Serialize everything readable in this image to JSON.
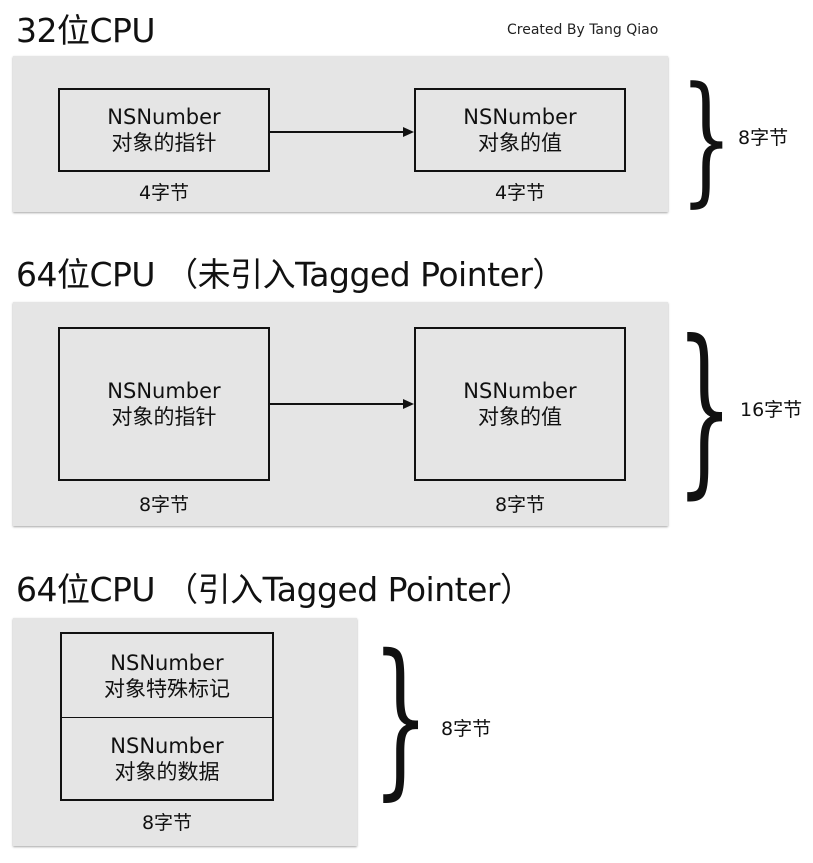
{
  "credit": "Created By Tang Qiao",
  "sections": [
    {
      "title": "32位CPU",
      "left_box": {
        "line1": "NSNumber",
        "line2": "对象的指针"
      },
      "right_box": {
        "line1": "NSNumber",
        "line2": "对象的值"
      },
      "left_size": "4字节",
      "right_size": "4字节",
      "total": "8字节"
    },
    {
      "title": "64位CPU （未引入Tagged Pointer）",
      "left_box": {
        "line1": "NSNumber",
        "line2": "对象的指针"
      },
      "right_box": {
        "line1": "NSNumber",
        "line2": "对象的值"
      },
      "left_size": "8字节",
      "right_size": "8字节",
      "total": "16字节"
    },
    {
      "title": "64位CPU （引入Tagged Pointer）",
      "top_box": {
        "line1": "NSNumber",
        "line2": "对象特殊标记"
      },
      "bottom_box": {
        "line1": "NSNumber",
        "line2": "对象的数据"
      },
      "size": "8字节",
      "total": "8字节"
    }
  ]
}
